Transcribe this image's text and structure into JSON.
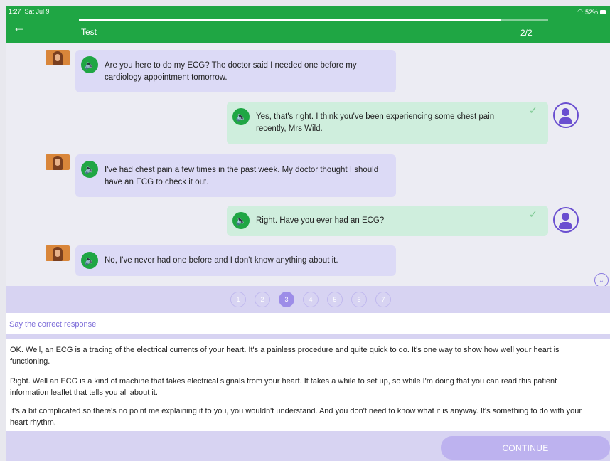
{
  "status": {
    "time": "1:27",
    "date": "Sat Jul 9",
    "battery": "52%"
  },
  "header": {
    "title": "Test",
    "counter": "2/2",
    "progress": 0.9
  },
  "messages": [
    {
      "speaker": "patient",
      "text": "Are you here to do my ECG? The doctor said I needed one before my cardiology appointment tomorrow."
    },
    {
      "speaker": "user",
      "text": "Yes, that's right. I think you've been experiencing some chest pain recently, Mrs Wild."
    },
    {
      "speaker": "patient",
      "text": "I've had chest pain a few times in the past week. My doctor thought I should have an ECG to check it out."
    },
    {
      "speaker": "user",
      "text": "Right. Have you ever had an ECG?"
    },
    {
      "speaker": "patient",
      "text": "No, I've never had one before and I don't know anything about it."
    }
  ],
  "pager": {
    "pages": [
      "1",
      "2",
      "3",
      "4",
      "5",
      "6",
      "7"
    ],
    "current": 3
  },
  "prompt": "Say the correct response",
  "options": [
    "OK. Well, an ECG is a tracing of the electrical currents of your heart. It's a painless procedure and quite quick to do. It's one way to show how well your heart is functioning.",
    "Right. Well an ECG is a kind of machine that takes electrical signals from your heart. It takes a while to set up, so while I'm doing that you can read this patient information leaflet that tells you all about it.",
    "It's a bit complicated so there's no point me explaining it to you, you wouldn't understand. And you don't need to know what it is anyway. It's something to do with your heart rhythm."
  ],
  "continue_label": "CONTINUE",
  "icons": {
    "back": "arrow-left-icon",
    "speaker": "speaker-icon",
    "check": "check-icon",
    "user": "user-avatar-icon",
    "scroll": "chevron-down-icon"
  },
  "colors": {
    "header": "#1fa644",
    "accent": "#6a4fd0",
    "patient_bubble": "#dcdaf6",
    "user_bubble": "#cfeedd"
  }
}
